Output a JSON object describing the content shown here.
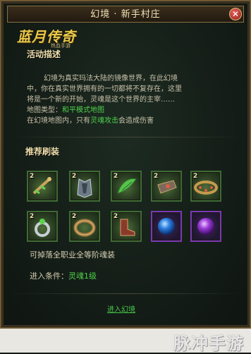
{
  "window": {
    "title": "幻境 · 新手村庄",
    "close_glyph": "✕"
  },
  "logo": {
    "main": "蓝月传奇",
    "sub": "热血手游"
  },
  "activity": {
    "heading": "活动描述",
    "lines": [
      "幻境为真实玛法大陆的镜像世界，在此幻境",
      "中，你在真实世界拥有的一切都将不复存在，这里",
      "将是一个新的开始，灵魂是这个世界的主宰……"
    ],
    "map_type_label": "地图类型：",
    "map_type_value": "和平模式地图",
    "harm_prefix": "在幻境地图内，只有",
    "harm_highlight": "灵魂攻击",
    "harm_suffix": "会造成伤害"
  },
  "recommend": {
    "heading": "推荐刷装",
    "items": [
      {
        "icon": "necklace-icon",
        "level": "2"
      },
      {
        "icon": "armor-icon",
        "level": "2"
      },
      {
        "icon": "wing-icon",
        "level": "2"
      },
      {
        "icon": "bracer-icon",
        "level": "2"
      },
      {
        "icon": "belt-icon",
        "level": "2"
      },
      {
        "icon": "ring-icon",
        "level": "2"
      },
      {
        "icon": "bracelet-icon",
        "level": "2"
      },
      {
        "icon": "boots-icon",
        "level": "2"
      },
      {
        "icon": "blue-orb-icon",
        "level": ""
      },
      {
        "icon": "purple-orb-icon",
        "level": ""
      }
    ]
  },
  "drop_text": "可掉落全职业全等阶魂装",
  "condition": {
    "label": "进入条件：",
    "value": "灵魂1级"
  },
  "enter_link": "进入幻境",
  "watermark": "脉冲手游",
  "colors": {
    "accent_gold": "#efdfae",
    "link_green": "#48c74a",
    "frame": "#6f5a35"
  }
}
